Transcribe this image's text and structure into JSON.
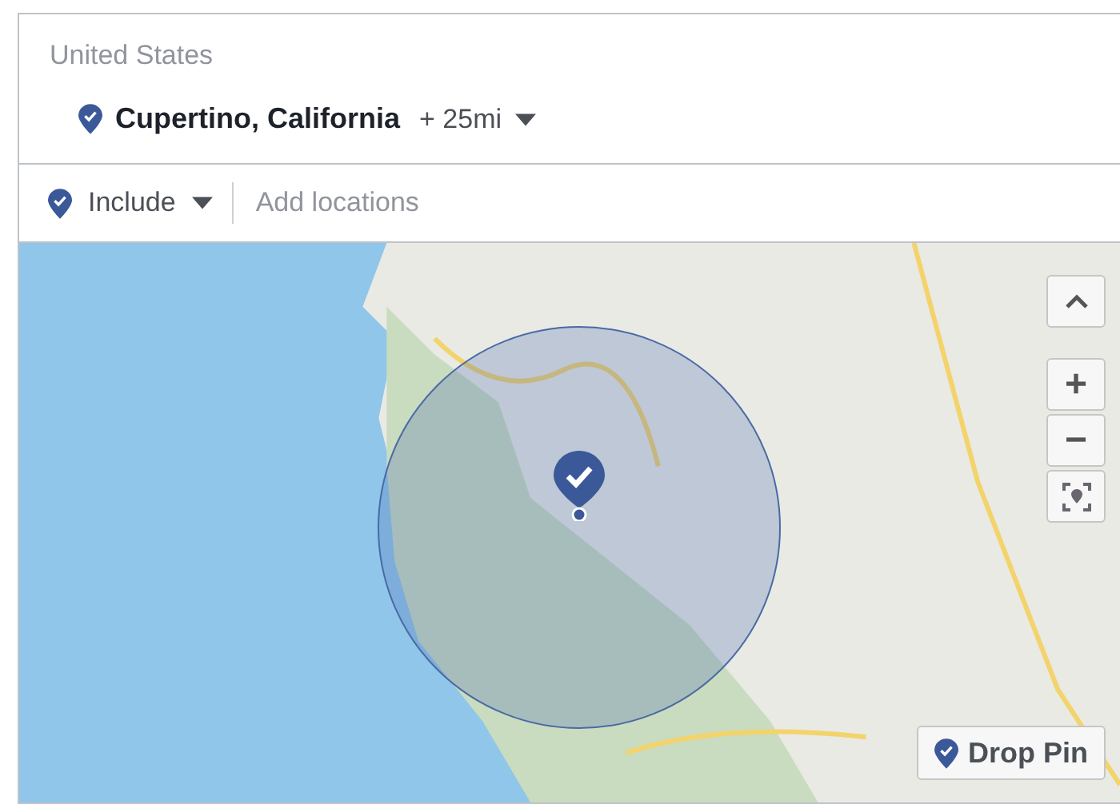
{
  "country": "United States",
  "location": {
    "name": "Cupertino, California",
    "radius": "+ 25mi"
  },
  "include": {
    "label": "Include",
    "placeholder": "Add locations"
  },
  "map": {
    "zoom_in": "+",
    "zoom_out": "−",
    "drop_pin": "Drop Pin"
  }
}
